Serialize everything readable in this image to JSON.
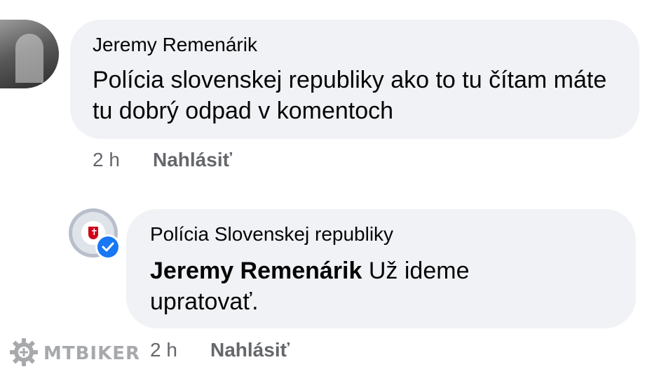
{
  "comments": [
    {
      "author": "Jeremy Remenárik",
      "text": "Polícia slovenskej republiky ako to tu čítam máte tu dobrý odpad v komentoch",
      "time": "2 h",
      "report_label": "Nahlásiť"
    },
    {
      "author": "Polícia Slovenskej republiky",
      "mention": "Jeremy Remenárik",
      "text": " Už ideme upratovať.",
      "time": "2 h",
      "report_label": "Nahlásiť",
      "verified": true
    }
  ],
  "watermark": {
    "text": "MTBIKER",
    "icon": "gear-icon"
  },
  "colors": {
    "bubble": "#f0f2f5",
    "meta": "#65676b",
    "verified": "#1877f2"
  }
}
